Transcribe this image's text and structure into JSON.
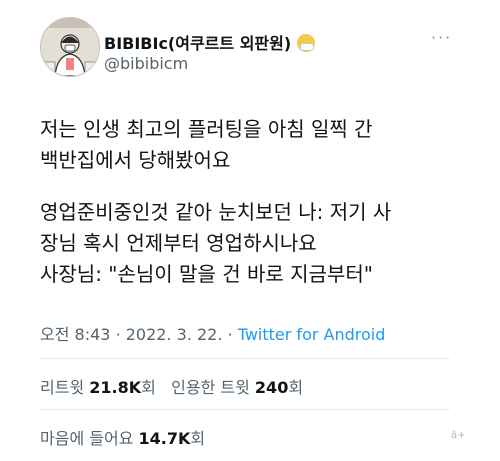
{
  "tweet": {
    "display_name": "BIBIBIc(여쿠르트 외판원)",
    "emoji_icon": "mask-face-emoji-icon",
    "handle": "@bibibicm",
    "more_icon": "more-horizontal-icon",
    "paragraphs": [
      [
        "저는 인생 최고의 플러팅을 아침 일찍 간",
        "백반집에서 당해봤어요"
      ],
      [
        "영업준비중인것 같아 눈치보던 나: 저기 사",
        "장님 혹시 언제부터 영업하시나요",
        "사장님: \"손님이 말을 건 바로 지금부터\""
      ]
    ],
    "time": "오전 8:43",
    "separator": "·",
    "date": "2022. 3. 22.",
    "source": "Twitter for Android",
    "retweet_label": "리트윗",
    "retweet_count": "21.8K",
    "retweet_unit": "회",
    "quote_label": "인용한 트윗",
    "quote_count": "240",
    "quote_unit": "회",
    "like_label": "마음에 들어요",
    "like_count": "14.7K",
    "like_unit": "회",
    "watermark": "ã+"
  },
  "colors": {
    "text": "#0f1419",
    "muted": "#536471",
    "link": "#1d9bf0",
    "divider": "#e6ecf0"
  }
}
